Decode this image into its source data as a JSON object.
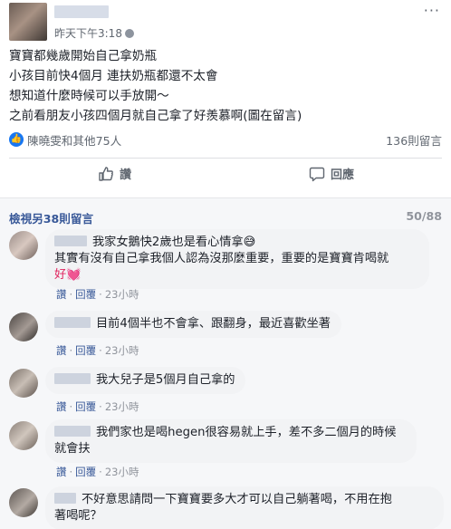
{
  "post": {
    "time": "昨天下午3:18",
    "more_icon": "more-dots-icon",
    "lines": [
      "寶寶都幾歲開始自己拿奶瓶",
      "小孩目前快4個月 連扶奶瓶都還不太會",
      "想知道什麼時候可以手放開～",
      "之前看朋友小孩四個月就自己拿了好羨慕啊(圖在留言)"
    ]
  },
  "stats": {
    "reactions": "陳曉雯和其他75人",
    "comments_count": "136則留言"
  },
  "actions": {
    "like": "讚",
    "comment": "回應"
  },
  "comments_header": {
    "view_more": "檢視另38則留言",
    "pager": "50/88"
  },
  "comment_meta": {
    "like": "讚",
    "reply": "回覆",
    "time": "23小時"
  },
  "comments": [
    {
      "text_line1": "我家女鵝快2歲也是看心情拿😅",
      "text_line2": "其實有沒有自己拿我個人認為沒那麼重要，重要的是寶寶肯喝就",
      "text_line3": "好💓"
    },
    {
      "text": "目前4個半也不會拿、跟翻身，最近喜歡坐著"
    },
    {
      "text": "我大兒子是5個月自己拿的"
    },
    {
      "text_line1": "我們家也是喝hegen很容易就上手，差不多二個月的時候",
      "text_line2": "就會扶"
    },
    {
      "text_line1": "不好意思請問一下寶寶要多大才可以自己躺著喝，不用在抱",
      "text_line2": "著喝呢？"
    }
  ],
  "colors": {
    "link": "#385898",
    "like_blue": "#1877f2",
    "bubble": "#f2f3f5"
  }
}
